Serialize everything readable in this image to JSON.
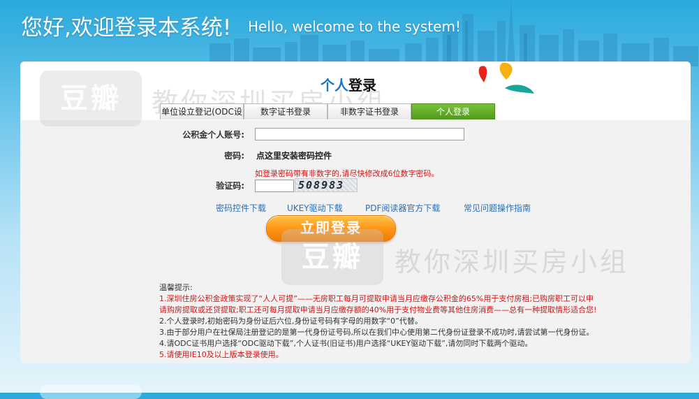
{
  "header": {
    "title_cn": "您好,欢迎登录本系统!",
    "title_en": "Hello, welcome to the system!"
  },
  "login": {
    "title_accent": "个人",
    "title_rest": "登录"
  },
  "tabs": [
    {
      "label": "单位设立登记(ODC设",
      "active": false
    },
    {
      "label": "数字证书登录",
      "active": false
    },
    {
      "label": "非数字证书登录",
      "active": false
    },
    {
      "label": "个人登录",
      "active": true
    }
  ],
  "form": {
    "account_label": "公积金个人账号:",
    "account_value": "",
    "password_label": "密码:",
    "password_install_link": "点这里安装密码控件",
    "password_warning": "如登录密码带有非数字的,请尽快修改成6位数字密码。",
    "captcha_label": "验证码:",
    "captcha_value": "",
    "captcha_image_text": "508983"
  },
  "links": [
    "密码控件下载",
    "UKEY驱动下载",
    "PDF阅读器官方下载",
    "常见问题操作指南"
  ],
  "submit_label": "立即登录",
  "tips": {
    "title": "温馨提示:",
    "item1_line1": "1.深圳住房公积金政策实现了“人人可提”——无房职工每月可提取申请当月应缴存公积金的65%用于支付房租;已购房职工可以申",
    "item1_line2": "请购房提取或还贷提取;职工还可每月提取申请当月应缴存额的40%用于支付物业费等其他住房消费——总有一种提取情形适合您!",
    "item2": "2.个人登录时,初始密码为身份证后六位,身份证号码有字母的用数字“0”代替。",
    "item3": "3.由于部分用户在社保局注册登记的是第一代身份证号码,所以在我们中心使用第二代身份证登录不成功时,请尝试第一代身份证。",
    "item4": "4.请ODC证书用户选择“ODC驱动下载”,个人证书(旧证书)用户选择“UKEY驱动下载”,请勿同时下载两个驱动。",
    "item5": "5.请使用IE10及以上版本登录使用。"
  },
  "watermark": {
    "badge": "豆瓣",
    "text": "教你深圳买房小组"
  },
  "colors": {
    "accent_blue": "#1976c8",
    "tab_active": "#5fa82a",
    "warning_red": "#d11616",
    "link_blue": "#2a6fb7",
    "button_orange": "#ff9a1a"
  }
}
